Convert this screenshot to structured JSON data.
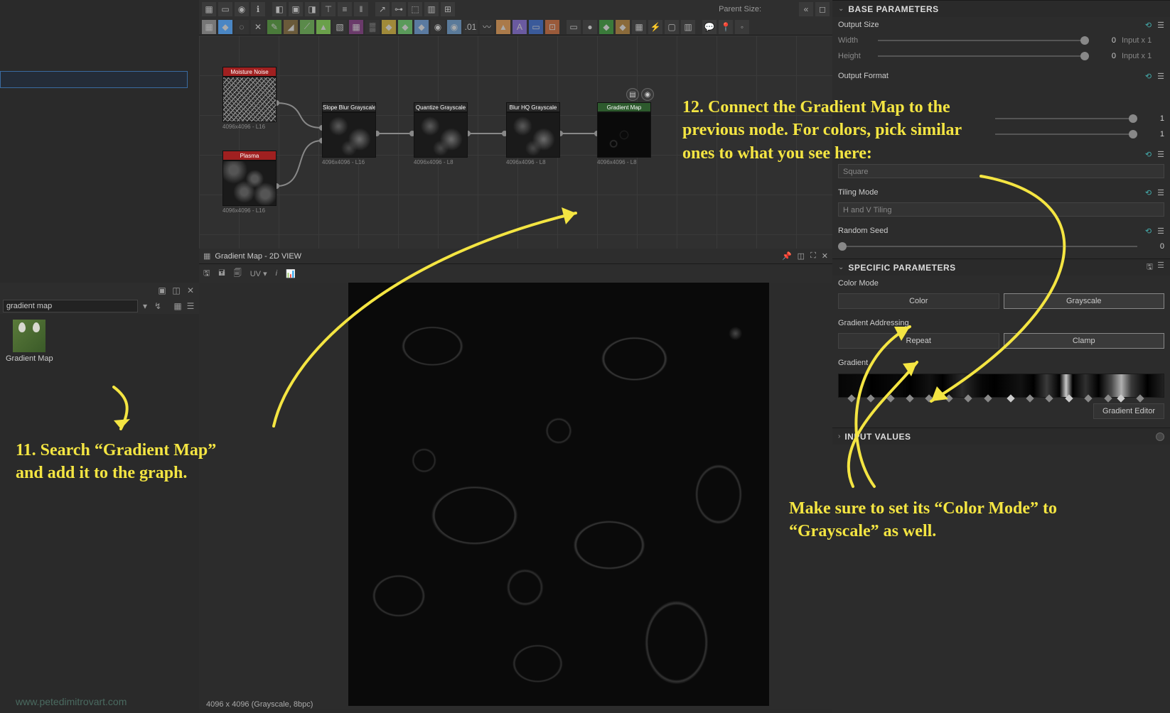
{
  "toolbar": {
    "parent_size_label": "Parent Size:"
  },
  "library": {
    "search_value": "gradient map",
    "item_label": "Gradient Map"
  },
  "graph": {
    "nodes": {
      "moisture": {
        "label": "Moisture Noise",
        "res": "4096x4096 - L16"
      },
      "plasma": {
        "label": "Plasma",
        "res": "4096x4096 - L16"
      },
      "slope": {
        "label": "Slope Blur Grayscale",
        "res": "4096x4096 - L16"
      },
      "quantize": {
        "label": "Quantize Grayscale",
        "res": "4096x4096 - L8"
      },
      "blurhq": {
        "label": "Blur HQ Grayscale",
        "res": "4096x4096 - L8"
      },
      "gradmap": {
        "label": "Gradient Map",
        "res": "4096x4096 - L8"
      }
    }
  },
  "view2d": {
    "title": "Gradient Map - 2D VIEW",
    "uv_label": "UV",
    "status": "4096 x 4096 (Grayscale, 8bpc)"
  },
  "properties": {
    "base_title": "BASE PARAMETERS",
    "output_size": "Output Size",
    "width": "Width",
    "height": "Height",
    "zero": "0",
    "input_x1": "Input x 1",
    "one": "1",
    "output_format": "Output Format",
    "square": "Square",
    "tiling_mode": "Tiling Mode",
    "tiling_value": "H and V Tiling",
    "random_seed": "Random Seed",
    "specific_title": "SPECIFIC PARAMETERS",
    "color_mode": "Color Mode",
    "color": "Color",
    "grayscale": "Grayscale",
    "grad_addressing": "Gradient Addressing",
    "repeat": "Repeat",
    "clamp": "Clamp",
    "gradient": "Gradient",
    "grad_editor": "Gradient Editor",
    "input_values": "INPUT VALUES"
  },
  "annotations": {
    "a11": "11. Search “Gradient Map” and add it to the graph.",
    "a12": "12. Connect the Gradient Map to the previous node. For colors, pick similar ones to what you see here:",
    "a_mode": "Make sure to set its “Color Mode” to “Grayscale” as well."
  },
  "watermark": "www.petedimitrovart.com"
}
